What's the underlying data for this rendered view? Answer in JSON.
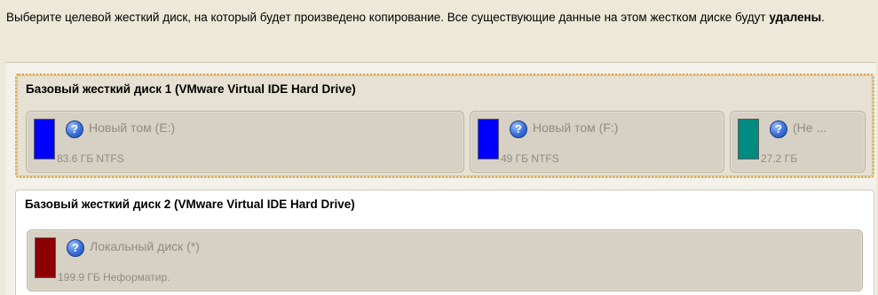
{
  "instruction": {
    "text": "Выберите целевой жесткий диск, на который будет произведено копирование. Все существующие данные на этом жестком диске будут ",
    "bold": "удалены",
    "end": "."
  },
  "disks": [
    {
      "title": "Базовый жесткий диск 1 (VMware Virtual IDE Hard Drive)",
      "partitions": [
        {
          "name": "Новый том (E:)",
          "info": "83.6 ГБ NTFS",
          "color": "#0000ff"
        },
        {
          "name": "Новый том (F:)",
          "info": "49 ГБ NTFS",
          "color": "#0000ff"
        },
        {
          "name": "(Не ...",
          "info": "27.2 ГБ",
          "color": "#008b80"
        }
      ]
    },
    {
      "title": "Базовый жесткий диск 2 (VMware Virtual IDE Hard Drive)",
      "partitions": [
        {
          "name": "Локальный диск (*)",
          "info": "199.9 ГБ Неформатир.",
          "color": "#8b0000"
        }
      ]
    }
  ],
  "icons": {
    "help": "help-icon",
    "help_glyph": "?"
  }
}
